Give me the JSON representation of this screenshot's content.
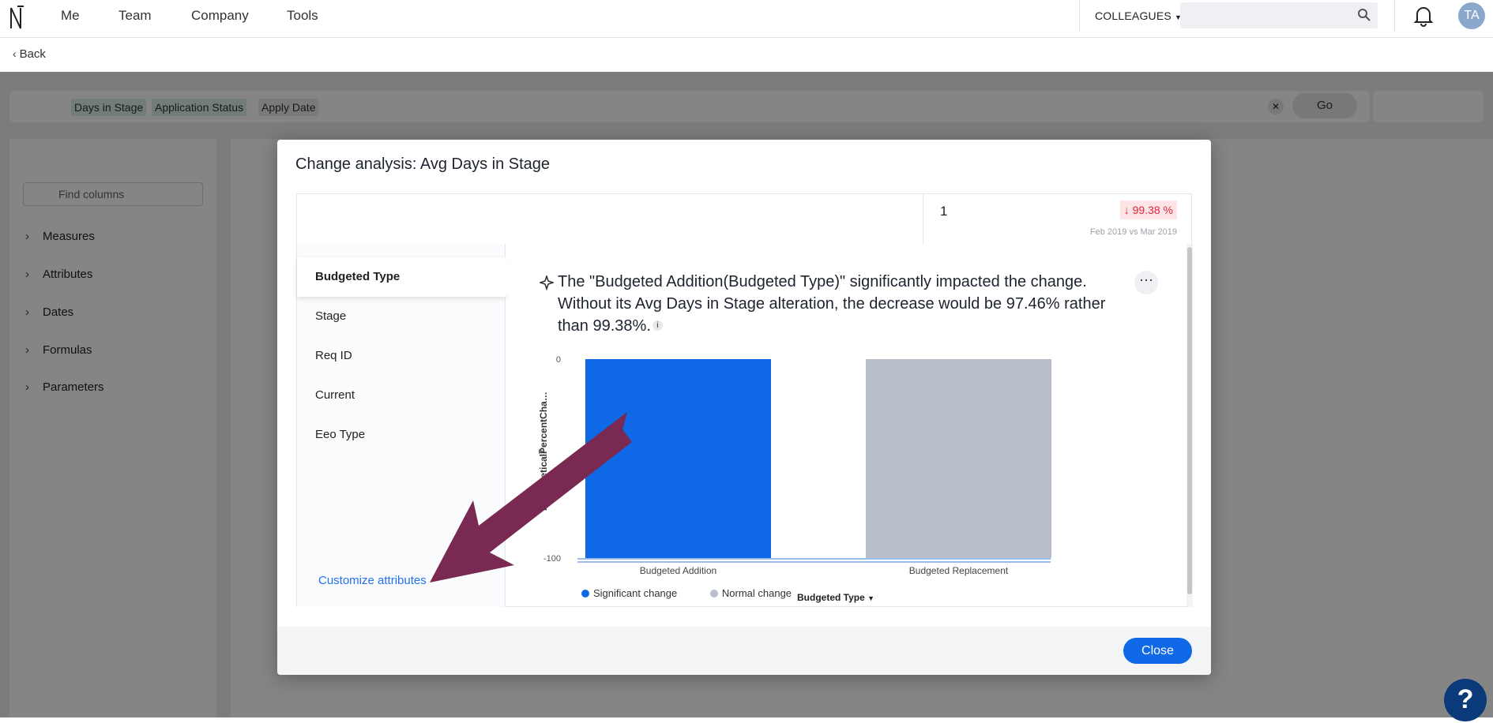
{
  "topnav": {
    "items": [
      "Me",
      "Team",
      "Company",
      "Tools"
    ],
    "colleagues_label": "COLLEAGUES",
    "avatar_initials": "TA"
  },
  "back_label": "Back",
  "search": {
    "chips": [
      "Days in Stage",
      "Application Status",
      "Apply Date"
    ],
    "go_label": "Go"
  },
  "left_panel": {
    "find_placeholder": "Find columns",
    "tree": [
      "Measures",
      "Attributes",
      "Dates",
      "Formulas",
      "Parameters"
    ]
  },
  "modal": {
    "title": "Change analysis: Avg Days in Stage",
    "summary_value": "1",
    "delta": "↓ 99.38 %",
    "period": "Feb 2019 vs Mar 2019",
    "attributes": [
      "Budgeted Type",
      "Stage",
      "Req ID",
      "Current",
      "Eeo Type"
    ],
    "active_attribute": "Budgeted Type",
    "customize_label": "Customize attributes",
    "insight_text": "The \"Budgeted Addition(Budgeted Type)\" significantly impacted the change. Without its Avg Days in Stage alteration, the decrease would be 97.46% rather than 99.38%.",
    "close_label": "Close"
  },
  "chart_data": {
    "type": "bar",
    "categories": [
      "Budgeted Addition",
      "Budgeted Replacement"
    ],
    "values": [
      -100,
      -100
    ],
    "colors": [
      "#0f69e6",
      "#b7bec9"
    ],
    "xlabel": "Budgeted Type",
    "ylabel": "HypotheticalPercentCha…",
    "ylim": [
      -100,
      0
    ],
    "yticks": [
      "0",
      "-100"
    ],
    "legend": [
      {
        "name": "Significant change",
        "color": "#0f69e6"
      },
      {
        "name": "Normal change",
        "color": "#b7bec9"
      }
    ]
  },
  "colors": {
    "accent": "#0f69e6",
    "annotation_arrow": "#7a2a52",
    "delta_red": "#e0243b"
  }
}
